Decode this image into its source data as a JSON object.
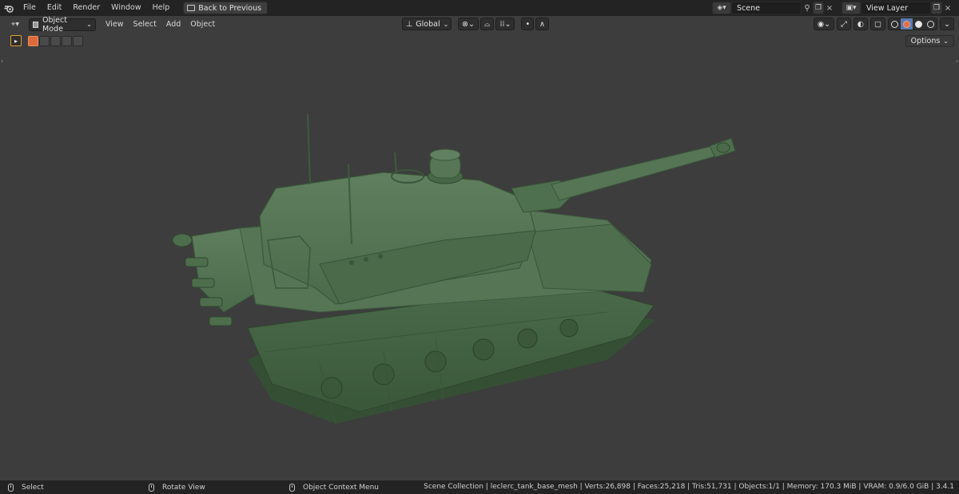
{
  "topbar": {
    "menus": [
      "File",
      "Edit",
      "Render",
      "Window",
      "Help"
    ],
    "back_button": "Back to Previous",
    "scene": "Scene",
    "view_layer": "View Layer"
  },
  "header": {
    "mode": "Object Mode",
    "menus": [
      "View",
      "Select",
      "Add",
      "Object"
    ],
    "orientation": "Global"
  },
  "toolrow": {
    "options": "Options"
  },
  "statusbar": {
    "hint_select": "Select",
    "hint_rotate": "Rotate View",
    "hint_context": "Object Context Menu",
    "stats": "Scene Collection | leclerc_tank_base_mesh | Verts:26,898 | Faces:25,218 | Tris:51,731 | Objects:1/1 | Memory: 170.3 MiB | VRAM: 0.9/6.0 GiB | 3.4.1"
  },
  "colors": {
    "viewport_bg": "#3d3d3d",
    "tank_green": "#4e6e4e",
    "active_orange": "#dd6a3d"
  }
}
